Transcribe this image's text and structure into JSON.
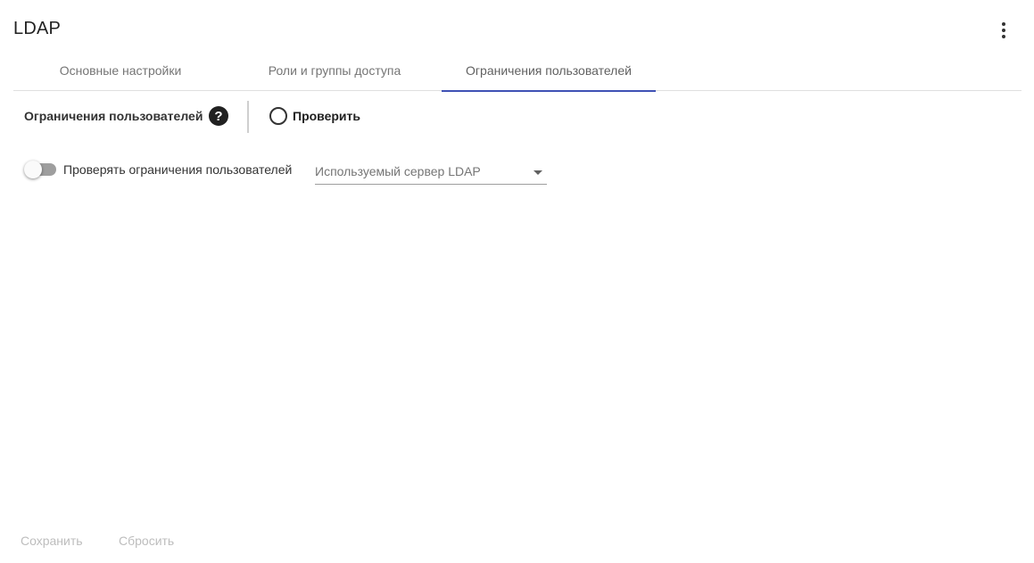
{
  "header": {
    "title": "LDAP",
    "menu_icon": "more-vert-icon"
  },
  "tabs": [
    {
      "label": "Основные настройки",
      "active": false
    },
    {
      "label": "Роли и группы доступа",
      "active": false
    },
    {
      "label": "Ограничения пользователей",
      "active": true
    }
  ],
  "accent_color": "#3f51b5",
  "section": {
    "label": "Ограничения пользователей",
    "help_icon": "help-circle-icon",
    "help_glyph": "?",
    "check_label": "Проверить",
    "check_icon": "radio-circle-icon"
  },
  "form": {
    "toggle_label": "Проверять ограничения пользователей",
    "toggle_on": false,
    "server_select_placeholder": "Используемый сервер LDAP",
    "server_select_value": ""
  },
  "footer": {
    "save_label": "Сохранить",
    "reset_label": "Сбросить"
  }
}
